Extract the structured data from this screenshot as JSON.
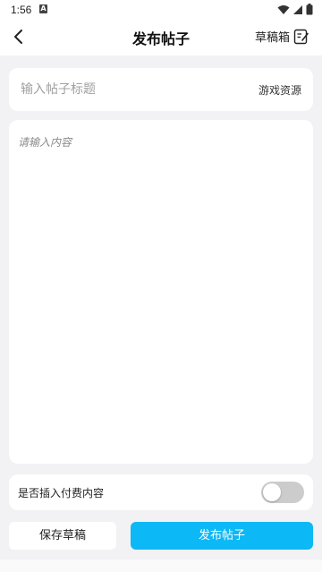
{
  "status_bar": {
    "time": "1:56",
    "notif_glyph": "A"
  },
  "header": {
    "title": "发布帖子",
    "drafts_label": "草稿箱"
  },
  "title_field": {
    "placeholder": "输入帖子标题",
    "value": "",
    "game_resource_label": "游戏资源"
  },
  "content_field": {
    "placeholder": "请输入内容",
    "value": ""
  },
  "paid_content": {
    "label": "是否插入付费内容",
    "enabled": false
  },
  "actions": {
    "save_label": "保存草稿",
    "publish_label": "发布帖子"
  },
  "colors": {
    "accent": "#0cb8f5",
    "background": "#f2f2f4",
    "toggle_off": "#cccccc"
  },
  "icons": {
    "back": "chevron-left-icon",
    "drafts": "edit-note-icon",
    "wifi": "wifi-icon",
    "signal": "signal-icon",
    "battery": "battery-icon"
  }
}
